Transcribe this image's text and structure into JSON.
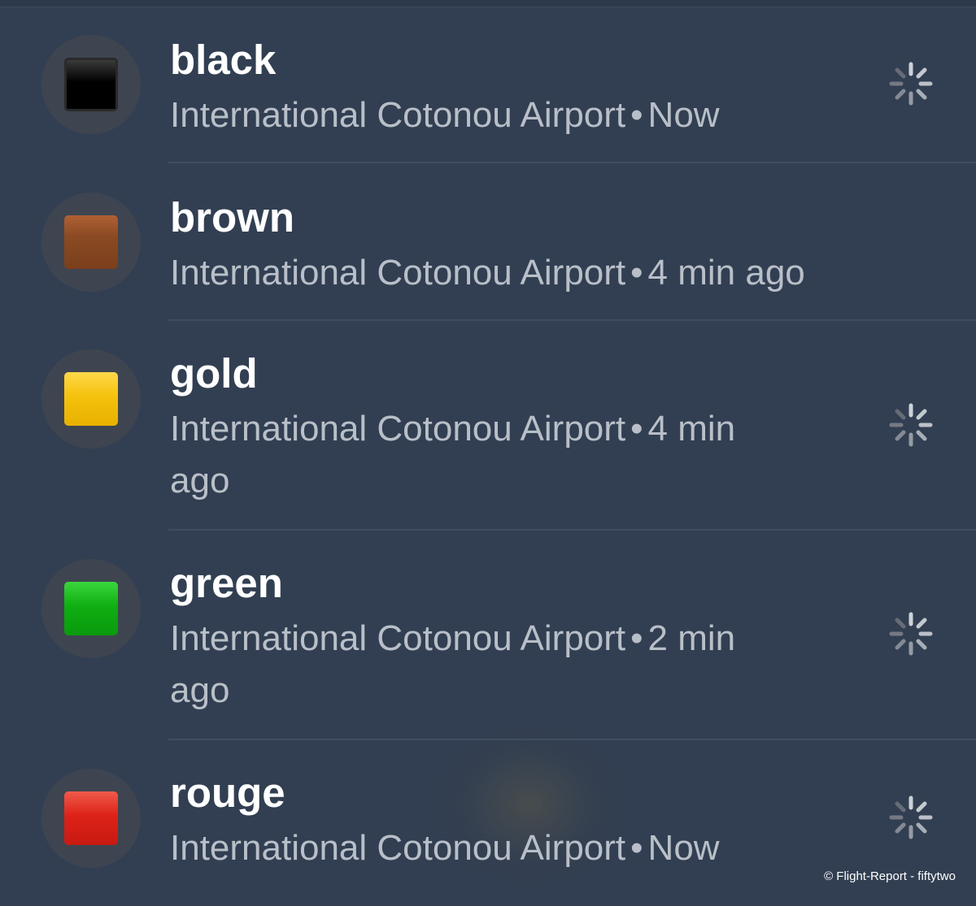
{
  "notifications": [
    {
      "title": "black",
      "location": "International Cotonou Airport",
      "separator": "•",
      "time": "Now",
      "swatch_color": "#050505",
      "icon": "black-square-icon",
      "spinner": "loading-spinner-icon"
    },
    {
      "title": "brown",
      "location": "International Cotonou Airport",
      "separator": "•",
      "time": "4 min ago",
      "swatch_color": "#8b4a22",
      "icon": "brown-square-icon"
    },
    {
      "title": "gold",
      "location": "International Cotonou Airport",
      "separator": "•",
      "time": "4 min ago",
      "swatch_color": "#f4c20d",
      "icon": "yellow-square-icon",
      "spinner": "loading-spinner-icon"
    },
    {
      "title": "green",
      "location": "International Cotonou Airport",
      "separator": "•",
      "time": "2 min ago",
      "swatch_color": "#0fae12",
      "icon": "green-square-icon",
      "spinner": "loading-spinner-icon"
    },
    {
      "title": "rouge",
      "location": "International Cotonou Airport",
      "separator": "•",
      "time": "Now",
      "swatch_color": "#dd2218",
      "icon": "red-square-icon",
      "spinner": "loading-spinner-icon"
    }
  ],
  "credit": "© Flight-Report - fiftytwo",
  "colors": {
    "background": "#323f52",
    "title_text": "#ffffff",
    "subtitle_text": "#b9bfc8",
    "icon_circle": "#3e4550",
    "divider": "#3f4c60"
  }
}
